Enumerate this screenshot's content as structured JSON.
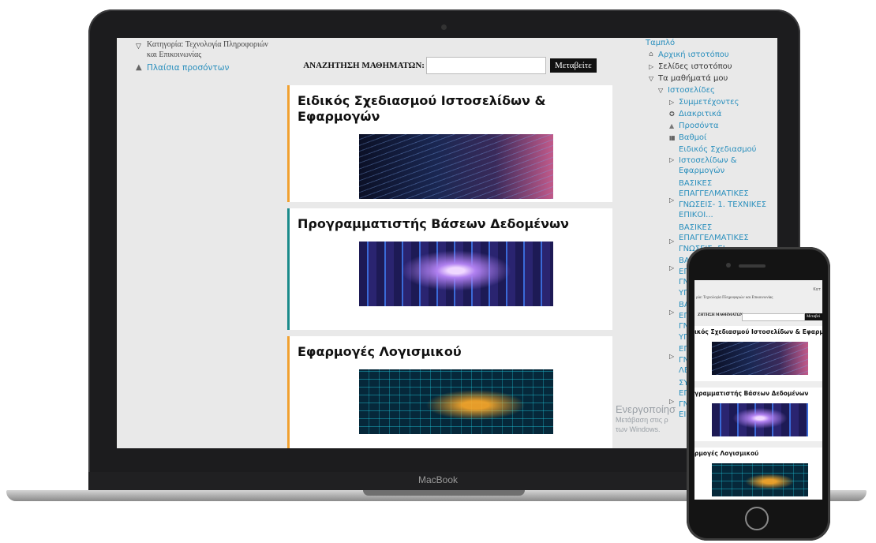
{
  "laptop": {
    "brand": "MacBook",
    "left": {
      "category": "Κατηγορία: Τεχνολογία Πληροφοριών και Επικοινωνίας",
      "badges_link": "Πλαίσια προσόντων"
    },
    "search": {
      "label": "ΑΝΑΖΗΤΗΣΗ ΜΑΘΗΜΑΤΩΝ:",
      "value": "",
      "button": "Μεταβείτε"
    },
    "courses": [
      {
        "title": "Ειδικός Σχεδιασμού Ιστοσελίδων & Εφαρμογών",
        "accent": "#f0a030"
      },
      {
        "title": "Προγραμματιστής Βάσεων Δεδομένων",
        "accent": "#1b8a8a"
      },
      {
        "title": "Εφαρμογές Λογισμικού",
        "accent": "#f0a030"
      }
    ],
    "nav": {
      "dashboard": "Ταμπλό",
      "home": "Αρχική ιστοτόπου",
      "site_pages": "Σελίδες ιστοτόπου",
      "my_courses": "Τα μαθήματά μου",
      "websites": "Ιστοσελίδες",
      "participants": "Συμμετέχοντες",
      "badges": "Διακριτικά",
      "competencies": "Προσόντα",
      "grades": "Βαθμοί",
      "course_1": "Ειδικός Σχεδιασμού Ιστοσελίδων & Εφαρμογών",
      "course_2": "ΒΑΣΙΚΕΣ ΕΠΑΓΓΕΛΜΑΤΙΚΕΣ ΓΝΩΣΕΙΣ- 1. ΤΕΧΝΙΚΕΣ ΕΠΙΚΟΙ...",
      "course_3": "ΒΑΣΙΚΕΣ ΕΠΑΓΓΕΛΜΑΤΙΚΕΣ ΓΝΩΣΕΙΣ- ΕΙ...",
      "course_4": "ΒΑ ΕΠ ΓΝ ΥΠ",
      "course_5": "ΒΑ ΕΠ ΓΝ ΥΠ",
      "course_6": "ΕΠ ΓΝ ΛΕ",
      "course_7": "ΣΥ ΕΠ ΓΝ ΕΙ"
    },
    "watermark": {
      "line1": "Ενεργοποίησ",
      "line2": "Μετάβαση στις ρ",
      "line3": "των Windows."
    }
  },
  "phone": {
    "category": "ρία: Τεχνολογία Πληροφοριών και Επικοινωνίας",
    "corner": "Κατ",
    "search": {
      "label": "ΖΗΤΗΣΗ ΜΑΘΗΜΑΤΩΝ:",
      "button": "Μεταβεί"
    },
    "courses": [
      {
        "title": "ικός Σχεδιασμού Ιστοσελίδων & Εφαρμογ"
      },
      {
        "title": "γραμματιστής Βάσεων Δεδομένων"
      },
      {
        "title": "ρμογές Λογισμικού"
      }
    ]
  }
}
